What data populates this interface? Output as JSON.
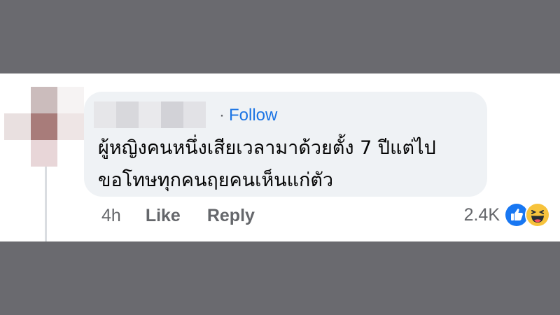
{
  "comment": {
    "follow_label": "Follow",
    "separator": "·",
    "text": "ผู้หญิงคนหนึ่งเสียเวลามาด้วยตั้ง 7 ปีแต่ไปขอโทษทุกคนฤยคนเห็นแก่ตัว",
    "timestamp": "4h",
    "like_label": "Like",
    "reply_label": "Reply",
    "reaction_count": "2.4K",
    "reactions": [
      "like-icon",
      "haha-icon"
    ]
  },
  "colors": {
    "link": "#1b74e4",
    "bubble": "#eff2f5",
    "meta_text": "#65676b",
    "like_blue": "#1877f2",
    "haha_yellow": "#f7c33c"
  }
}
